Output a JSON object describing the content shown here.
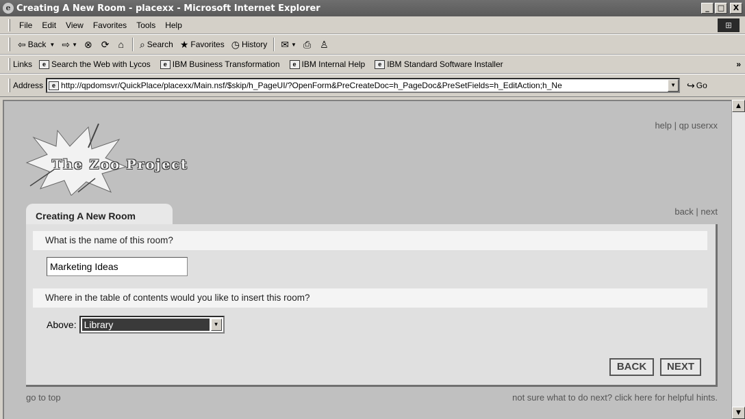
{
  "window": {
    "title": "Creating A New Room - placexx - Microsoft Internet Explorer",
    "minimize": "_",
    "maximize": "□",
    "close": "X"
  },
  "menu": [
    "File",
    "Edit",
    "View",
    "Favorites",
    "Tools",
    "Help"
  ],
  "toolbar": {
    "back": "Back",
    "search": "Search",
    "favorites": "Favorites",
    "history": "History"
  },
  "links": {
    "label": "Links",
    "items": [
      "Search the Web with Lycos",
      "IBM Business Transformation",
      "IBM Internal Help",
      "IBM Standard Software Installer"
    ]
  },
  "address": {
    "label": "Address",
    "url": "http://qpdomsvr/QuickPlace/placexx/Main.nsf/$skip/h_PageUI/?OpenForm&PreCreateDoc=h_PageDoc&PreSetFields=h_EditAction;h_Ne",
    "go": "Go"
  },
  "page": {
    "logo_text": "The Zoo Project",
    "help": "help",
    "separator": " | ",
    "user": "qp userxx",
    "tab_title": "Creating A New Room",
    "back_link": "back",
    "next_link": "next",
    "q1": "What is the name of this room?",
    "room_name": "Marketing Ideas",
    "q2": "Where in the table of contents would you like to insert this room?",
    "above_label": "Above:",
    "above_value": "Library",
    "back_button": "BACK",
    "next_button": "NEXT",
    "go_to_top": "go to top",
    "hint": "not sure what to do next? click here for helpful hints."
  }
}
